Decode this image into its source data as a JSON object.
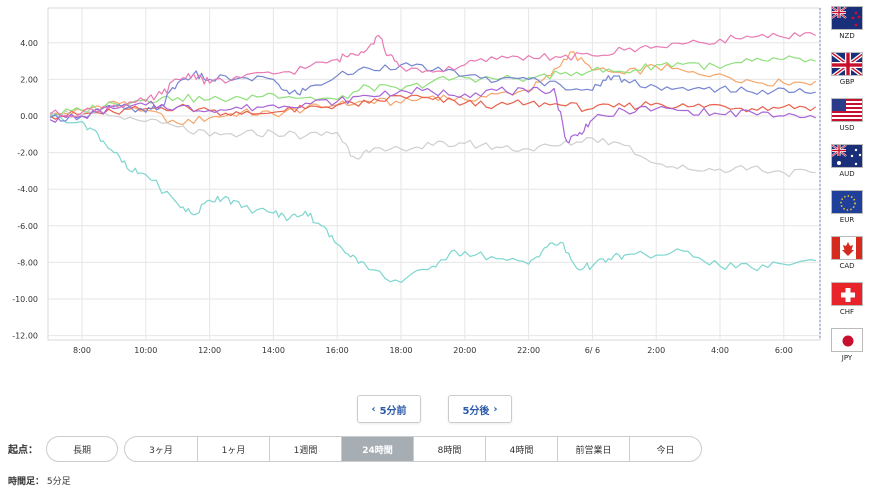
{
  "chart_data": {
    "type": "line",
    "ylim": [
      -12,
      6
    ],
    "y_ticks": [
      "4.00",
      "2.00",
      "0.00",
      "-2.00",
      "-4.00",
      "-6.00",
      "-8.00",
      "-10.00",
      "-12.00"
    ],
    "y_tick_values": [
      4,
      2,
      0,
      -2,
      -4,
      -6,
      -8,
      -10,
      -12
    ],
    "x_range": [
      7.0,
      31.0
    ],
    "x_ticks": [
      "8:00",
      "10:00",
      "12:00",
      "14:00",
      "16:00",
      "18:00",
      "20:00",
      "22:00",
      "6/ 6",
      "2:00",
      "4:00",
      "6:00"
    ],
    "x_tick_values": [
      8,
      10,
      12,
      14,
      16,
      18,
      20,
      22,
      24,
      26,
      28,
      30
    ],
    "grid": true,
    "legend_position": "bottom",
    "series": [
      {
        "name": "USD",
        "color": "#f5a66b",
        "x": [
          7.0,
          8.0,
          9.0,
          10.0,
          11.0,
          12.0,
          13.0,
          14.0,
          15.0,
          16.0,
          17.0,
          18.0,
          19.0,
          20.0,
          21.0,
          22.0,
          22.7,
          23.3,
          24.0,
          25.0,
          26.0,
          27.0,
          28.0,
          29.0,
          30.0,
          31.0
        ],
        "y": [
          0.0,
          0.3,
          0.8,
          0.3,
          -0.4,
          -0.1,
          0.2,
          0.1,
          0.4,
          0.6,
          0.8,
          0.7,
          1.1,
          0.9,
          1.2,
          1.4,
          2.2,
          3.5,
          2.5,
          2.3,
          2.7,
          2.4,
          2.3,
          1.9,
          1.8,
          1.9
        ]
      },
      {
        "name": "EUR",
        "color": "#e8604c",
        "x": [
          7.0,
          8.0,
          9.0,
          10.0,
          11.0,
          12.0,
          13.0,
          14.0,
          15.0,
          16.0,
          17.0,
          18.0,
          19.0,
          20.0,
          21.0,
          22.0,
          23.0,
          24.0,
          25.0,
          26.0,
          27.0,
          28.0,
          29.0,
          30.0,
          31.0
        ],
        "y": [
          0.0,
          0.1,
          0.2,
          0.4,
          0.5,
          0.3,
          0.1,
          0.2,
          0.4,
          0.6,
          0.7,
          1.1,
          0.9,
          0.7,
          0.6,
          0.7,
          0.6,
          0.4,
          0.5,
          0.7,
          0.5,
          0.6,
          0.4,
          0.5,
          0.5
        ]
      },
      {
        "name": "GBP",
        "color": "#8ee07a",
        "x": [
          7.0,
          8.0,
          9.0,
          10.0,
          11.0,
          12.0,
          13.0,
          14.0,
          15.0,
          16.0,
          17.0,
          18.0,
          19.0,
          20.0,
          21.0,
          22.0,
          23.0,
          24.0,
          25.0,
          26.0,
          27.0,
          28.0,
          29.0,
          30.0,
          31.0
        ],
        "y": [
          0.1,
          0.3,
          0.7,
          0.9,
          1.0,
          0.9,
          1.0,
          1.2,
          1.0,
          0.9,
          1.6,
          1.4,
          1.9,
          2.1,
          2.0,
          2.1,
          2.3,
          2.5,
          2.4,
          2.8,
          2.9,
          2.6,
          3.0,
          3.1,
          3.0
        ]
      },
      {
        "name": "JPY",
        "color": "#7ed6cf",
        "x": [
          7.0,
          8.0,
          8.5,
          9.0,
          9.5,
          10.0,
          11.0,
          11.5,
          12.0,
          12.5,
          13.0,
          14.0,
          14.5,
          15.0,
          15.5,
          16.0,
          16.5,
          17.0,
          18.0,
          19.0,
          19.5,
          20.0,
          21.0,
          22.0,
          22.5,
          23.0,
          23.5,
          24.0,
          24.5,
          25.0,
          26.0,
          27.0,
          28.0,
          29.0,
          30.0,
          31.0
        ],
        "y": [
          0.0,
          -0.3,
          -1.0,
          -2.0,
          -3.0,
          -3.2,
          -4.8,
          -5.4,
          -4.6,
          -4.4,
          -5.0,
          -5.3,
          -5.6,
          -5.2,
          -6.0,
          -7.0,
          -7.6,
          -8.4,
          -9.1,
          -8.2,
          -7.6,
          -7.4,
          -7.8,
          -8.1,
          -7.2,
          -6.9,
          -8.3,
          -8.2,
          -7.8,
          -7.6,
          -7.6,
          -7.4,
          -8.2,
          -8.3,
          -8.1,
          -7.9
        ]
      },
      {
        "name": "CHF",
        "color": "#cfcfcf",
        "x": [
          7.0,
          8.0,
          9.0,
          10.0,
          11.0,
          12.0,
          13.0,
          14.0,
          15.0,
          16.0,
          16.5,
          17.0,
          18.0,
          19.0,
          20.0,
          21.0,
          22.0,
          23.0,
          24.0,
          25.0,
          26.0,
          27.0,
          28.0,
          29.0,
          30.0,
          31.0
        ],
        "y": [
          0.2,
          0.1,
          0.0,
          -0.3,
          -0.6,
          -1.1,
          -1.0,
          -0.9,
          -1.1,
          -0.9,
          -2.2,
          -2.0,
          -1.8,
          -1.6,
          -1.5,
          -1.7,
          -1.8,
          -1.6,
          -1.2,
          -1.6,
          -2.6,
          -2.9,
          -2.9,
          -2.8,
          -3.1,
          -3.1
        ]
      },
      {
        "name": "AUD",
        "color": "#7585d1",
        "x": [
          7.0,
          8.0,
          9.0,
          10.0,
          10.5,
          11.0,
          11.5,
          12.0,
          13.0,
          14.0,
          14.5,
          15.0,
          16.0,
          17.0,
          18.0,
          19.0,
          20.0,
          21.0,
          22.0,
          23.0,
          24.0,
          24.5,
          25.0,
          26.0,
          27.0,
          28.0,
          29.0,
          30.0,
          31.0
        ],
        "y": [
          -0.1,
          0.0,
          0.5,
          0.2,
          0.6,
          1.8,
          2.3,
          2.0,
          2.1,
          2.0,
          1.2,
          1.4,
          2.2,
          2.6,
          2.8,
          2.5,
          2.2,
          1.9,
          2.0,
          1.7,
          1.4,
          2.2,
          2.0,
          1.6,
          1.4,
          1.5,
          1.3,
          1.5,
          1.3
        ]
      },
      {
        "name": "CAD",
        "color": "#a864d6",
        "x": [
          7.0,
          8.0,
          9.0,
          10.0,
          11.0,
          12.0,
          13.0,
          14.0,
          15.0,
          16.0,
          17.0,
          18.0,
          19.0,
          20.0,
          21.0,
          22.0,
          22.8,
          23.2,
          23.6,
          24.0,
          25.0,
          26.0,
          27.0,
          28.0,
          29.0,
          30.0,
          31.0
        ],
        "y": [
          -0.2,
          0.0,
          0.4,
          0.6,
          0.5,
          0.3,
          0.4,
          0.6,
          0.7,
          0.8,
          1.1,
          1.4,
          1.3,
          1.2,
          1.4,
          1.3,
          1.5,
          -1.4,
          -0.9,
          -0.2,
          0.3,
          0.4,
          0.3,
          0.1,
          0.2,
          0.0,
          -0.1
        ]
      },
      {
        "name": "NZD",
        "color": "#e87ab4",
        "x": [
          7.0,
          8.0,
          9.0,
          10.0,
          10.5,
          11.0,
          11.5,
          12.0,
          13.0,
          14.0,
          15.0,
          16.0,
          16.5,
          17.0,
          17.3,
          17.6,
          18.0,
          19.0,
          20.0,
          21.0,
          22.0,
          23.0,
          24.0,
          25.0,
          26.0,
          27.0,
          28.0,
          29.0,
          30.0,
          31.0
        ],
        "y": [
          0.1,
          0.2,
          0.6,
          0.8,
          1.2,
          2.0,
          2.3,
          1.8,
          2.1,
          2.3,
          2.6,
          3.1,
          3.4,
          3.8,
          4.4,
          3.3,
          2.7,
          2.4,
          2.8,
          3.1,
          3.3,
          3.2,
          3.3,
          3.6,
          3.8,
          4.0,
          4.2,
          4.3,
          4.3,
          4.4
        ]
      }
    ]
  },
  "legend": [
    {
      "label": "USD",
      "color": "#f5a66b"
    },
    {
      "label": "EUR",
      "color": "#e8604c"
    },
    {
      "label": "GBP",
      "color": "#8ee07a"
    },
    {
      "label": "JPY",
      "color": "#7ed6cf"
    },
    {
      "label": "CHF",
      "color": "#cfcfcf"
    },
    {
      "label": "AUD",
      "color": "#7585d1"
    },
    {
      "label": "CAD",
      "color": "#a864d6"
    },
    {
      "label": "NZD",
      "color": "#e87ab4"
    }
  ],
  "flags": [
    {
      "code": "NZD",
      "icon": "nz-flag-icon"
    },
    {
      "code": "GBP",
      "icon": "uk-flag-icon"
    },
    {
      "code": "USD",
      "icon": "us-flag-icon"
    },
    {
      "code": "AUD",
      "icon": "au-flag-icon"
    },
    {
      "code": "EUR",
      "icon": "eu-flag-icon"
    },
    {
      "code": "CAD",
      "icon": "ca-flag-icon"
    },
    {
      "code": "CHF",
      "icon": "ch-flag-icon"
    },
    {
      "code": "JPY",
      "icon": "jp-flag-icon"
    }
  ],
  "nav": {
    "prev_label": "5分前",
    "next_label": "5分後"
  },
  "period": {
    "start_label": "起点：",
    "long_label": "長期",
    "options": [
      "3ヶ月",
      "1ヶ月",
      "1週間",
      "24時間",
      "8時間",
      "4時間",
      "前営業日",
      "今日"
    ],
    "active": "24時間"
  },
  "timeframe": {
    "label": "時間足：",
    "value": "5分足"
  }
}
